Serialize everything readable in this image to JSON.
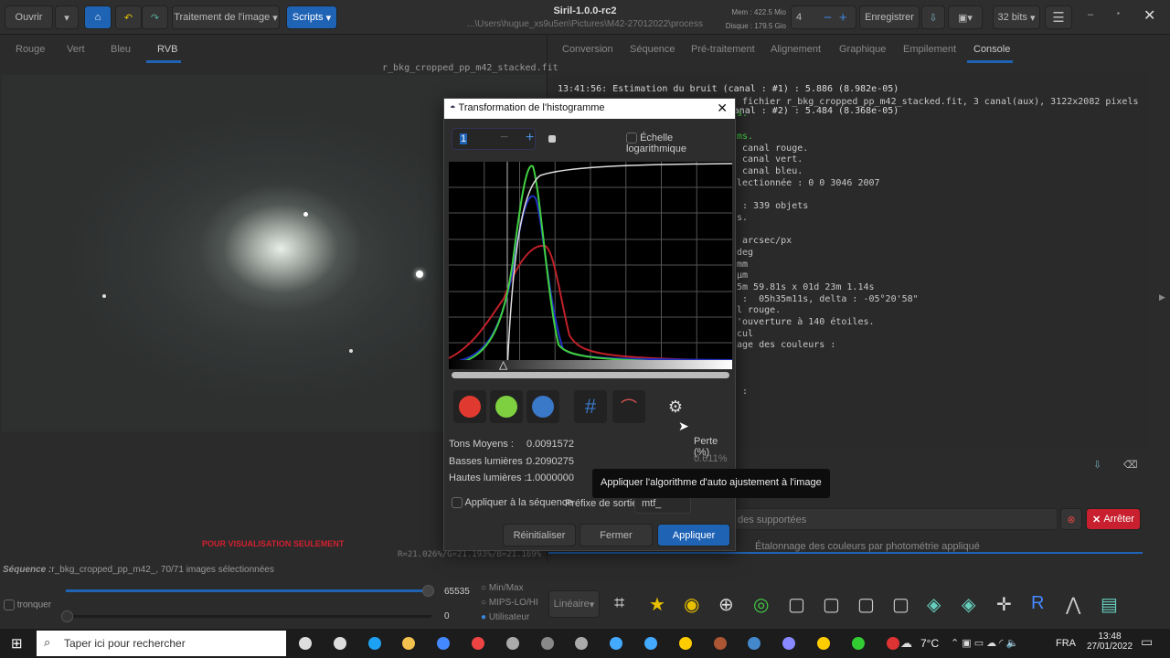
{
  "toolbar": {
    "open": "Ouvrir",
    "processing": "Traitement de l'image",
    "scripts": "Scripts",
    "title": "Siril-1.0.0-rc2",
    "path": "...\\Users\\hugue_xs9u5en\\Pictures\\M42-27012022\\process",
    "mem": "Mem : 422.5 Mio",
    "disk": "Disque : 179.5 Gio",
    "threads": "4",
    "save": "Enregistrer",
    "bits": "32 bits"
  },
  "view_tabs": [
    "Rouge",
    "Vert",
    "Bleu",
    "RVB"
  ],
  "right_tabs": [
    "Conversion",
    "Séquence",
    "Pré-traitement",
    "Alignement",
    "Graphique",
    "Empilement",
    "Console"
  ],
  "image": {
    "filename": "r_bkg_cropped_pp_m42_stacked.fit",
    "watermark": "POUR VISUALISATION SEULEMENT",
    "stats": "R=21.026%/G=21.193%/B=21.169%"
  },
  "console": [
    "13:41:56: Estimation du bruit (canal : #1) : 5.886 (8.982e-05)",
    "13:41:56: Estimation du bruit (canal : #2) : 5.484 (8.368e-05)",
    " fichier r_bkg_cropped_pp_m42_stacked.fit, 3 canal(aux), 3122x2082 pixels",
    "s.",
    "",
    "ms.",
    " canal rouge.",
    " canal vert.",
    " canal bleu.",
    "lectionnée : 0 0 3046 2007",
    "",
    " : 339 objets",
    "s.",
    "",
    " arcsec/px",
    "deg",
    "mm",
    "µm",
    "5m 59.81s x 01d 23m 1.14s",
    " :  05h35m11s, delta : -05°20'58\"",
    "l rouge.",
    "'ouverture à 140 étoiles.",
    "cul",
    "age des couleurs :",
    "",
    "",
    "",
    " :"
  ],
  "console_input_placeholder": "des supportées",
  "stop": "Arrêter",
  "status": "Étalonnage des couleurs par photométrie appliqué",
  "dialog": {
    "title": "Transformation de l'histogramme",
    "zoom": "1",
    "log_scale": "Échelle logarithmique",
    "midtones_label": "Tons Moyens :",
    "midtones": "0.0091572",
    "shadows_label": "Basses lumières :",
    "shadows": "0.2090275",
    "highlights_label": "Hautes lumières :",
    "highlights": "1.0000000",
    "loss_label": "Perte (%)",
    "loss": "0.611%",
    "apply_seq": "Appliquer à la séquence",
    "prefix_label": "Préfixe de sortie :",
    "prefix": "mtf_",
    "reset": "Réinitialiser",
    "close": "Fermer",
    "apply": "Appliquer",
    "tooltip": "Appliquer l'algorithme d'auto ajustement à l'image"
  },
  "bottom": {
    "sequence_label": "Séquence :",
    "sequence": "r_bkg_cropped_pp_m42_, 70/71 images sélectionnées",
    "truncate": "tronquer",
    "max": "65535",
    "min": "0",
    "minmax": "Min/Max",
    "mips": "MIPS-LO/HI",
    "user": "Utilisateur",
    "mode": "Linéaire"
  },
  "taskbar": {
    "search": "Taper ici pour rechercher",
    "temp": "7°C",
    "lang": "FRA",
    "time": "13:48",
    "date": "27/01/2022"
  }
}
